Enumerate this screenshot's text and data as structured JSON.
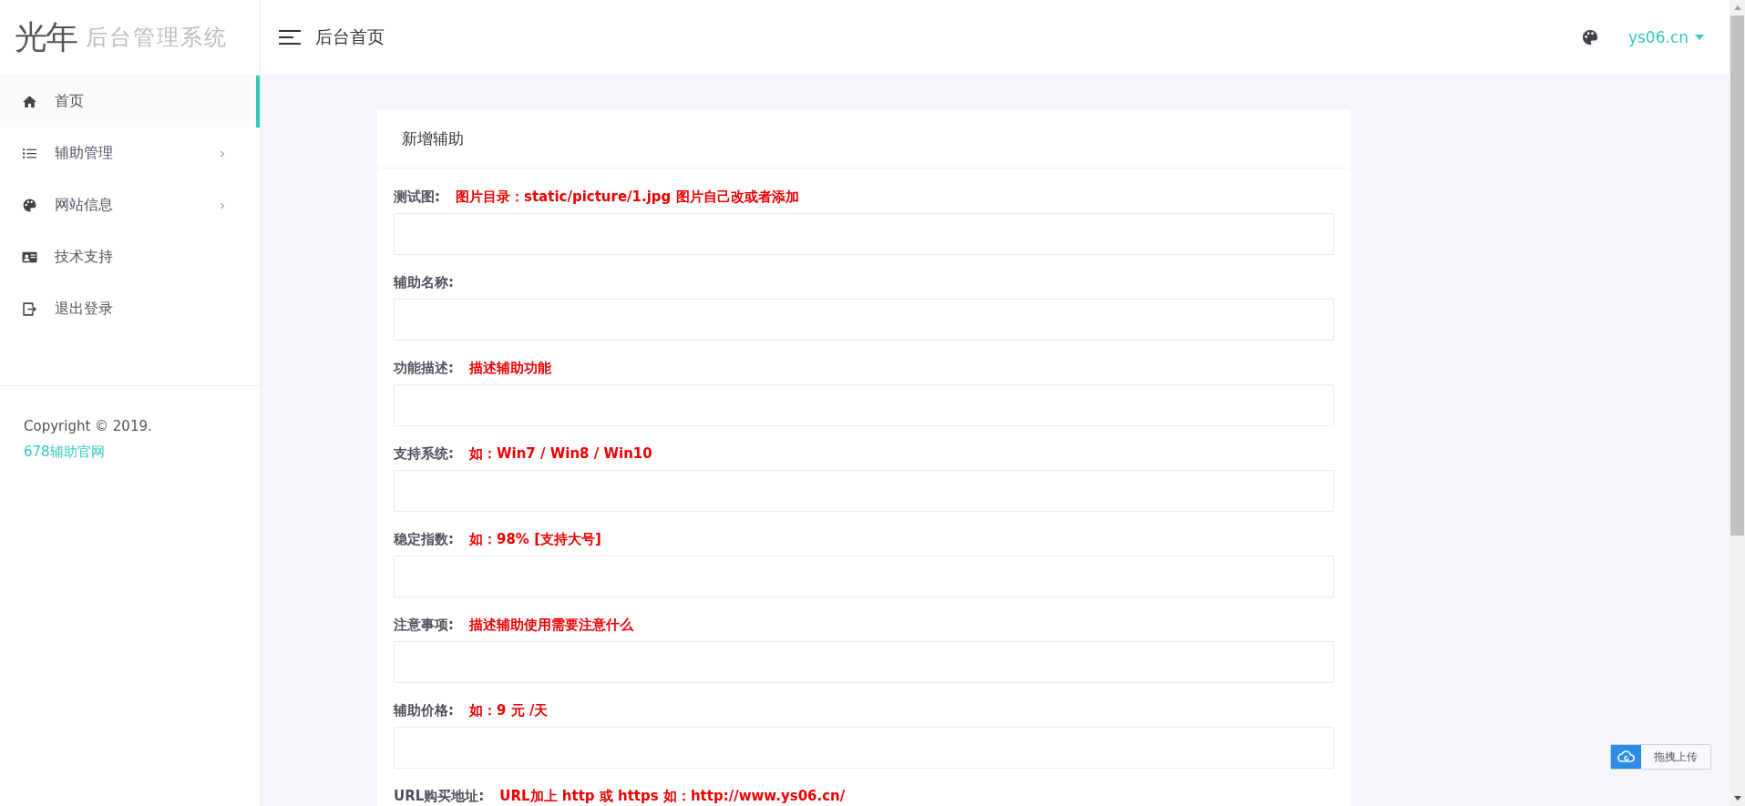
{
  "logo": {
    "mark": "光年",
    "title": "后台管理系统"
  },
  "header": {
    "breadcrumb": "后台首页",
    "user": "ys06.cn"
  },
  "sidebar": {
    "items": [
      {
        "label": "首页",
        "selected": true,
        "expandable": false
      },
      {
        "label": "辅助管理",
        "selected": false,
        "expandable": true
      },
      {
        "label": "网站信息",
        "selected": false,
        "expandable": true
      },
      {
        "label": "技术支持",
        "selected": false,
        "expandable": false
      },
      {
        "label": "退出登录",
        "selected": false,
        "expandable": false
      }
    ],
    "copyright": "Copyright © 2019.",
    "copyright_link": "678辅助官网"
  },
  "card": {
    "title": "新增辅助",
    "fields": [
      {
        "label": "测试图:",
        "hint": "图片目录：static/picture/1.jpg 图片自己改或者添加"
      },
      {
        "label": "辅助名称:"
      },
      {
        "label": "功能描述:",
        "hint": "描述辅助功能"
      },
      {
        "label": "支持系统:",
        "hint": "如：Win7 / Win8 / Win10"
      },
      {
        "label": "稳定指数:",
        "hint": "如：98% [支持大号]"
      },
      {
        "label": "注意事项:",
        "hint": "描述辅助使用需要注意什么"
      },
      {
        "label": "辅助价格:",
        "hint": "如：9 元 /天"
      },
      {
        "label": "URL购买地址:",
        "hint": "URL加上 http 或 https 如：http://www.ys06.cn/"
      }
    ]
  },
  "upload_widget": {
    "label": "拖拽上传"
  }
}
